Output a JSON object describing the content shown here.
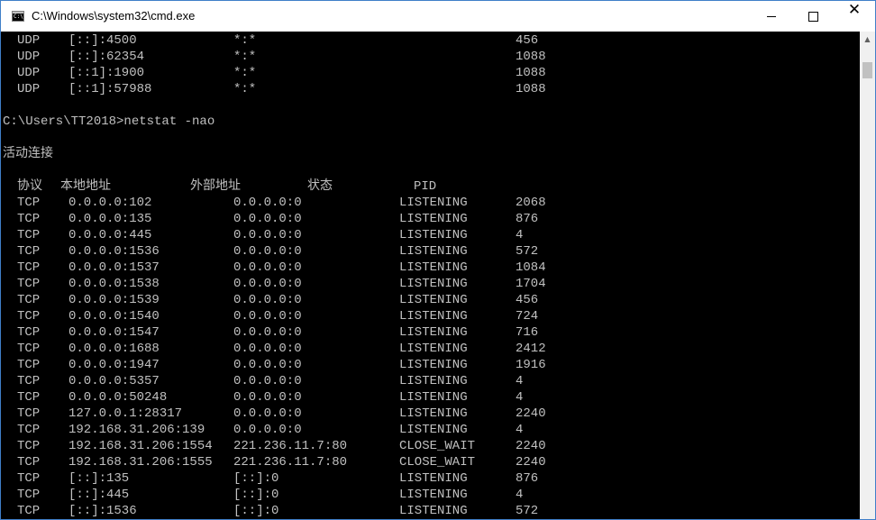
{
  "window": {
    "title": "C:\\Windows\\system32\\cmd.exe",
    "controls": {
      "minimize": "—",
      "maximize": "☐",
      "close": "✕"
    }
  },
  "console": {
    "udp_rows": [
      {
        "proto": "UDP",
        "local": "[::]:4500",
        "foreign": "*:*",
        "pid": "456"
      },
      {
        "proto": "UDP",
        "local": "[::]:62354",
        "foreign": "*:*",
        "pid": "1088"
      },
      {
        "proto": "UDP",
        "local": "[::1]:1900",
        "foreign": "*:*",
        "pid": "1088"
      },
      {
        "proto": "UDP",
        "local": "[::1]:57988",
        "foreign": "*:*",
        "pid": "1088"
      }
    ],
    "prompt": "C:\\Users\\TT2018>netstat -nao",
    "section_heading": "活动连接",
    "headers": {
      "proto": "协议",
      "local": "本地地址",
      "foreign": "外部地址",
      "state": "状态",
      "pid": "PID"
    },
    "rows": [
      {
        "proto": "TCP",
        "local": "0.0.0.0:102",
        "foreign": "0.0.0.0:0",
        "state": "LISTENING",
        "pid": "2068"
      },
      {
        "proto": "TCP",
        "local": "0.0.0.0:135",
        "foreign": "0.0.0.0:0",
        "state": "LISTENING",
        "pid": "876"
      },
      {
        "proto": "TCP",
        "local": "0.0.0.0:445",
        "foreign": "0.0.0.0:0",
        "state": "LISTENING",
        "pid": "4"
      },
      {
        "proto": "TCP",
        "local": "0.0.0.0:1536",
        "foreign": "0.0.0.0:0",
        "state": "LISTENING",
        "pid": "572"
      },
      {
        "proto": "TCP",
        "local": "0.0.0.0:1537",
        "foreign": "0.0.0.0:0",
        "state": "LISTENING",
        "pid": "1084"
      },
      {
        "proto": "TCP",
        "local": "0.0.0.0:1538",
        "foreign": "0.0.0.0:0",
        "state": "LISTENING",
        "pid": "1704"
      },
      {
        "proto": "TCP",
        "local": "0.0.0.0:1539",
        "foreign": "0.0.0.0:0",
        "state": "LISTENING",
        "pid": "456"
      },
      {
        "proto": "TCP",
        "local": "0.0.0.0:1540",
        "foreign": "0.0.0.0:0",
        "state": "LISTENING",
        "pid": "724"
      },
      {
        "proto": "TCP",
        "local": "0.0.0.0:1547",
        "foreign": "0.0.0.0:0",
        "state": "LISTENING",
        "pid": "716"
      },
      {
        "proto": "TCP",
        "local": "0.0.0.0:1688",
        "foreign": "0.0.0.0:0",
        "state": "LISTENING",
        "pid": "2412"
      },
      {
        "proto": "TCP",
        "local": "0.0.0.0:1947",
        "foreign": "0.0.0.0:0",
        "state": "LISTENING",
        "pid": "1916"
      },
      {
        "proto": "TCP",
        "local": "0.0.0.0:5357",
        "foreign": "0.0.0.0:0",
        "state": "LISTENING",
        "pid": "4"
      },
      {
        "proto": "TCP",
        "local": "0.0.0.0:50248",
        "foreign": "0.0.0.0:0",
        "state": "LISTENING",
        "pid": "4"
      },
      {
        "proto": "TCP",
        "local": "127.0.0.1:28317",
        "foreign": "0.0.0.0:0",
        "state": "LISTENING",
        "pid": "2240"
      },
      {
        "proto": "TCP",
        "local": "192.168.31.206:139",
        "foreign": "0.0.0.0:0",
        "state": "LISTENING",
        "pid": "4"
      },
      {
        "proto": "TCP",
        "local": "192.168.31.206:1554",
        "foreign": "221.236.11.7:80",
        "state": "CLOSE_WAIT",
        "pid": "2240"
      },
      {
        "proto": "TCP",
        "local": "192.168.31.206:1555",
        "foreign": "221.236.11.7:80",
        "state": "CLOSE_WAIT",
        "pid": "2240"
      },
      {
        "proto": "TCP",
        "local": "[::]:135",
        "foreign": "[::]:0",
        "state": "LISTENING",
        "pid": "876"
      },
      {
        "proto": "TCP",
        "local": "[::]:445",
        "foreign": "[::]:0",
        "state": "LISTENING",
        "pid": "4"
      },
      {
        "proto": "TCP",
        "local": "[::]:1536",
        "foreign": "[::]:0",
        "state": "LISTENING",
        "pid": "572"
      }
    ]
  },
  "scrollbar": {
    "up_arrow": "▲"
  }
}
